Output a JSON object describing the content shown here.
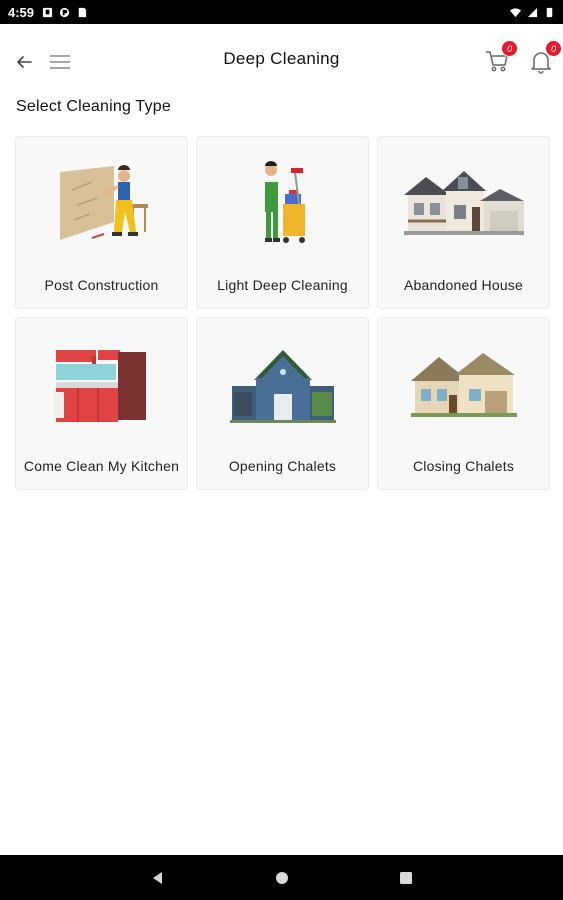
{
  "status_bar": {
    "time": "4:59",
    "left_icons": [
      "notification-a-icon",
      "notification-b-icon",
      "notification-c-icon"
    ],
    "right_icons": [
      "wifi-icon",
      "signal-icon",
      "battery-icon"
    ]
  },
  "app_bar": {
    "title": "Deep Cleaning",
    "back_icon": "back-arrow-icon",
    "menu_icon": "hamburger-menu-icon",
    "cart_icon": "cart-icon",
    "cart_count": "0",
    "bell_icon": "bell-icon",
    "notification_count": "0"
  },
  "section": {
    "title": "Select Cleaning Type"
  },
  "cards": [
    {
      "label": "Post Construction",
      "icon": "post-construction-illustration"
    },
    {
      "label": "Light Deep Cleaning",
      "icon": "light-deep-cleaning-illustration"
    },
    {
      "label": "Abandoned House",
      "icon": "abandoned-house-illustration"
    },
    {
      "label": "Come Clean My Kitchen",
      "icon": "kitchen-illustration"
    },
    {
      "label": "Opening Chalets",
      "icon": "opening-chalet-illustration"
    },
    {
      "label": "Closing Chalets",
      "icon": "closing-chalet-illustration"
    }
  ],
  "nav_bar": {
    "icons": [
      "nav-back-icon",
      "nav-home-icon",
      "nav-recents-icon"
    ]
  },
  "colors": {
    "badge": "#e8192c",
    "card_bg": "#f8f8f8",
    "text": "#111111"
  }
}
